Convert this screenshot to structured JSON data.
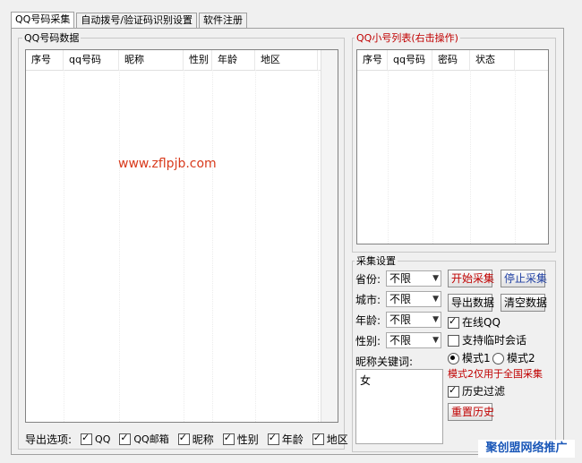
{
  "tabs": [
    {
      "label": "QQ号码采集"
    },
    {
      "label": "自动拨号/验证码识别设置"
    },
    {
      "label": "软件注册"
    }
  ],
  "data_group": {
    "title": "QQ号码数据",
    "columns": [
      "序号",
      "qq号码",
      "昵称",
      "性别",
      "年龄",
      "地区"
    ]
  },
  "watermark": "www.zflpjb.com",
  "export": {
    "label": "导出选项:",
    "options": [
      {
        "label": "QQ",
        "checked": true
      },
      {
        "label": "QQ邮箱",
        "checked": true
      },
      {
        "label": "昵称",
        "checked": true
      },
      {
        "label": "性别",
        "checked": true
      },
      {
        "label": "年龄",
        "checked": true
      },
      {
        "label": "地区",
        "checked": true
      }
    ]
  },
  "account_group": {
    "title": "QQ小号列表(右击操作)",
    "columns": [
      "序号",
      "qq号码",
      "密码",
      "状态"
    ]
  },
  "collect_group": {
    "title": "采集设置",
    "province_label": "省份:",
    "province_value": "不限",
    "city_label": "城市:",
    "city_value": "不限",
    "age_label": "年龄:",
    "age_value": "不限",
    "gender_label": "性别:",
    "gender_value": "不限",
    "keyword_label": "昵称关键词:",
    "keyword_value": "女",
    "start_btn": "开始采集",
    "stop_btn": "停止采集",
    "export_btn": "导出数据",
    "clear_btn": "清空数据",
    "online_label": "在线QQ",
    "temp_chat_label": "支持临时会话",
    "mode1_label": "模式1",
    "mode2_label": "模式2",
    "mode_note": "模式2仅用于全国采集",
    "history_label": "历史过滤",
    "reset_btn": "重置历史"
  },
  "brand": "聚创盟网络推广",
  "colors": {
    "accent_red": "#c00000",
    "accent_blue": "#1f3fa3",
    "watermark": "#d83a1c",
    "brand": "#1a57b8"
  }
}
